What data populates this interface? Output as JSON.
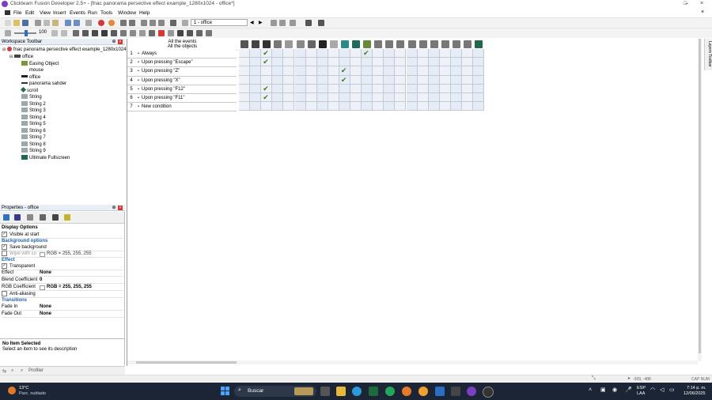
{
  "window": {
    "title": "Clickteam Fusion Developer 2.5+ - [fnac panorama persective effect example_1280x1024 - office*]",
    "controls": [
      "–",
      "□",
      "×"
    ]
  },
  "menu": [
    "File",
    "Edit",
    "View",
    "Insert",
    "Events",
    "Run",
    "Tools",
    "Window",
    "Help"
  ],
  "toolbar": {
    "zoom_value": "100",
    "frame_combo": "1 - office"
  },
  "workspace": {
    "header": "Workspace Toolbar",
    "root": "fnac panorama persective effect example_1280x1024 *",
    "frame": "office",
    "objects": [
      "Easing Object",
      "mouse",
      "office",
      "panorama sahder",
      "scroll",
      "String",
      "String 2",
      "String 3",
      "String 4",
      "String 5",
      "String 6",
      "String 7",
      "String 8",
      "String 9",
      "Ultimate Fullscreen"
    ]
  },
  "properties": {
    "header": "Properties - office",
    "rows": [
      {
        "type": "section",
        "label": "Display Options"
      },
      {
        "type": "check",
        "label": "Visible at start",
        "checked": true
      },
      {
        "type": "subsection",
        "label": "Background options"
      },
      {
        "type": "check",
        "label": "Save background",
        "checked": true
      },
      {
        "type": "checkval",
        "label": "Wipe with co",
        "checked": false,
        "value": "RGB = 255, 255, 255"
      },
      {
        "type": "subsection",
        "label": "Effect"
      },
      {
        "type": "check",
        "label": "Transparent",
        "checked": true
      },
      {
        "type": "value",
        "label": "Effect",
        "value": "None"
      },
      {
        "type": "value",
        "label": "Blend Coefficient",
        "value": "0"
      },
      {
        "type": "value",
        "label": "RGB Coefficient",
        "value": "RGB = 255, 255, 255"
      },
      {
        "type": "check",
        "label": "Anti-aliasing",
        "checked": false
      },
      {
        "type": "subsection",
        "label": "Transitions"
      },
      {
        "type": "value",
        "label": "Fade In",
        "value": "None"
      },
      {
        "type": "value",
        "label": "Fade Out",
        "value": "None"
      }
    ],
    "info_title": "No Item Selected",
    "info_text": "Select an item to see its description",
    "profiler_tab": "Profiler"
  },
  "event_editor": {
    "header_line1": "All the events",
    "header_line2": "All the objects",
    "events": [
      {
        "num": "1",
        "label": "Always",
        "checks": [
          2,
          11
        ]
      },
      {
        "num": "2",
        "label": "Upon pressing \"Escape\"",
        "checks": [
          2
        ]
      },
      {
        "num": "3",
        "label": "Upon pressing \"Z\"",
        "checks": [
          9
        ]
      },
      {
        "num": "4",
        "label": "Upon pressing \"X\"",
        "checks": [
          9
        ]
      },
      {
        "num": "5",
        "label": "Upon pressing \"F12\"",
        "checks": [
          2
        ]
      },
      {
        "num": "6",
        "label": "Upon pressing \"F11\"",
        "checks": [
          2
        ]
      },
      {
        "num": "7",
        "label": "New condition",
        "checks": []
      }
    ],
    "column_count": 22
  },
  "right_toolbar": "Layers Toolbar",
  "status_bar": {
    "coords": "-309, -488",
    "caps": "CAP NUM"
  },
  "taskbar": {
    "weather_temp": "13°C",
    "weather_desc": "Parc. nublado",
    "search": "Buscar",
    "lang1": "ESP",
    "lang2": "LAA",
    "time": "7:14 p. m.",
    "date": "12/06/2025"
  },
  "colors": {
    "accent": "#1f5fa8",
    "check_green": "#3a7a1a",
    "taskbar": "#1b2536"
  }
}
